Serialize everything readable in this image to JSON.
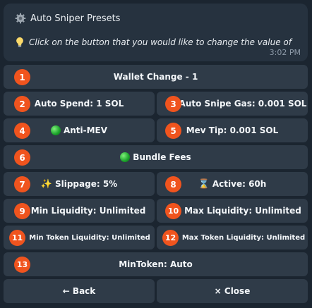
{
  "message": {
    "title": "Auto Sniper Presets",
    "text": "Click on the button that you would like to change the value of",
    "time": "3:02 PM",
    "title_icon": "gear-icon",
    "text_icon": "lightbulb-icon"
  },
  "buttons": {
    "wallet_change": {
      "badge": "1",
      "label": "Wallet Change - 1"
    },
    "auto_spend": {
      "badge": "2",
      "label": "Auto Spend: 1 SOL"
    },
    "auto_snipe_gas": {
      "badge": "3",
      "label": "Auto Snipe Gas: 0.001 SOL"
    },
    "anti_mev": {
      "badge": "4",
      "label": "Anti-MEV",
      "icon": "green-circle-icon"
    },
    "mev_tip": {
      "badge": "5",
      "label": "Mev Tip: 0.001 SOL"
    },
    "bundle_fees": {
      "badge": "6",
      "label": "Bundle Fees",
      "icon": "green-circle-icon"
    },
    "slippage": {
      "badge": "7",
      "label": "Slippage: 5%",
      "icon": "sparkles-icon"
    },
    "active": {
      "badge": "8",
      "label": "Active: 60h",
      "icon": "hourglass-icon"
    },
    "min_liquidity": {
      "badge": "9",
      "label": "Min Liquidity: Unlimited"
    },
    "max_liquidity": {
      "badge": "10",
      "label": "Max Liquidity: Unlimited"
    },
    "min_token_liquidity": {
      "badge": "11",
      "label": "Min Token Liquidity: Unlimited"
    },
    "max_token_liquidity": {
      "badge": "12",
      "label": "Max Token Liquidity: Unlimited"
    },
    "min_token": {
      "badge": "13",
      "label": "MinToken: Auto"
    },
    "back": {
      "label": "← Back"
    },
    "close": {
      "label": "× Close"
    }
  },
  "colors": {
    "background": "#1b2530",
    "message_bubble": "#26323f",
    "button": "#2f3b48",
    "badge": "#f0541e"
  }
}
